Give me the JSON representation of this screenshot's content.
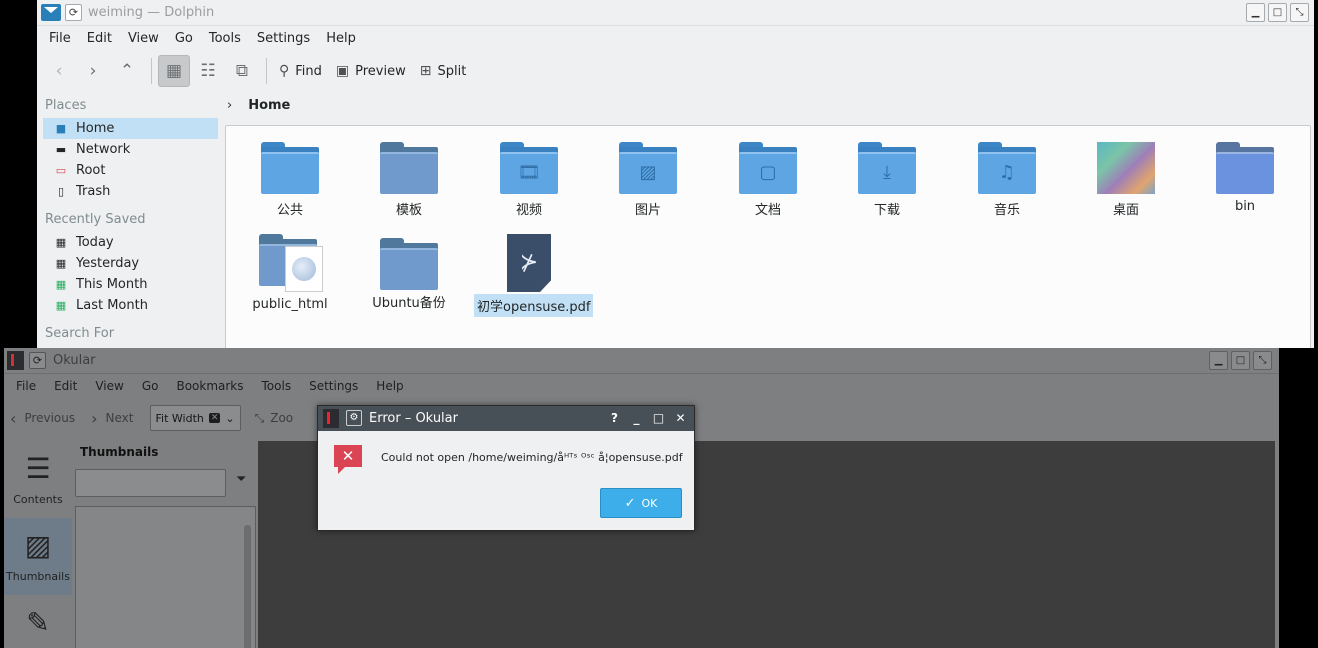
{
  "dolphin": {
    "title": "weiming — Dolphin",
    "menu": [
      "File",
      "Edit",
      "View",
      "Go",
      "Tools",
      "Settings",
      "Help"
    ],
    "toolbar": {
      "find": "Find",
      "preview": "Preview",
      "split": "Split"
    },
    "places": {
      "header": "Places",
      "items": [
        "Home",
        "Network",
        "Root",
        "Trash"
      ],
      "recent_header": "Recently Saved",
      "recent": [
        "Today",
        "Yesterday",
        "This Month",
        "Last Month"
      ],
      "search_header": "Search For"
    },
    "breadcrumb": "Home",
    "files": [
      "公共",
      "模板",
      "视频",
      "图片",
      "文档",
      "下载",
      "音乐",
      "桌面",
      "bin",
      "public_html",
      "Ubuntu备份",
      "初学opensuse.pdf"
    ]
  },
  "okular": {
    "title": "Okular",
    "menu": [
      "File",
      "Edit",
      "View",
      "Go",
      "Bookmarks",
      "Tools",
      "Settings",
      "Help"
    ],
    "toolbar": {
      "previous": "Previous",
      "next": "Next",
      "fit": "Fit Width",
      "zoom": "Zoo"
    },
    "side": {
      "contents": "Contents",
      "thumbnails": "Thumbnails"
    },
    "thumbs_title": "Thumbnails"
  },
  "dialog": {
    "title": "Error – Okular",
    "message": "Could not open /home/weiming/åᴴᵀˢ ᴼˢᶜ å¦opensuse.pdf",
    "ok": "OK",
    "help": "?",
    "min": "_",
    "max": "□",
    "close": "✕"
  }
}
